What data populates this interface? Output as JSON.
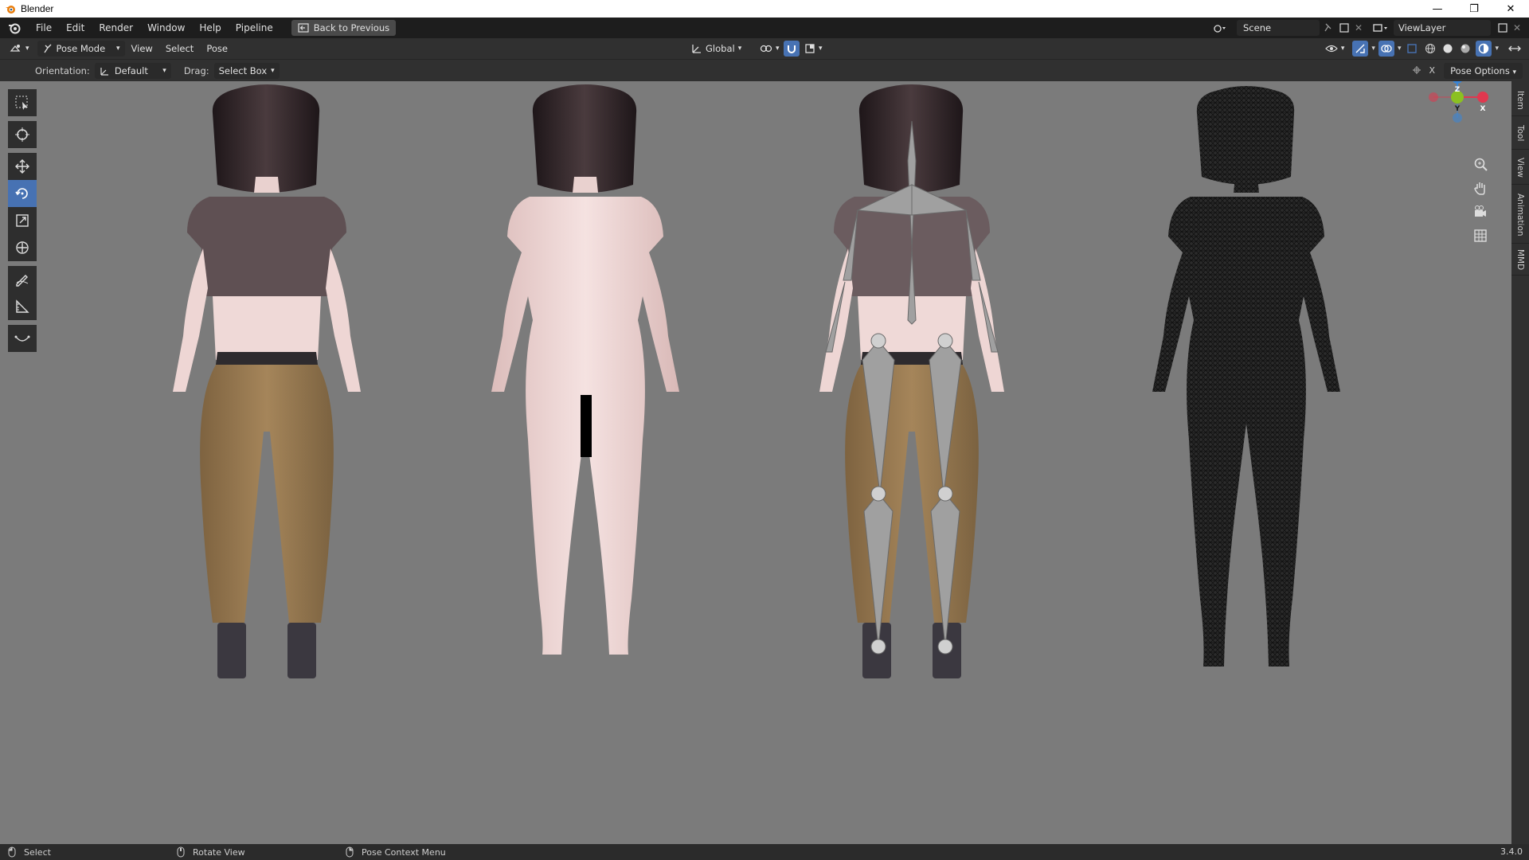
{
  "window": {
    "title": "Blender"
  },
  "menubar": {
    "items": [
      "File",
      "Edit",
      "Render",
      "Window",
      "Help",
      "Pipeline"
    ],
    "back_button": "Back to Previous",
    "scene": "Scene",
    "view_layer": "ViewLayer"
  },
  "header": {
    "mode": "Pose Mode",
    "menus": [
      "View",
      "Select",
      "Pose"
    ],
    "transform_orientation": "Global"
  },
  "tool_settings": {
    "orientation_label": "Orientation:",
    "orientation_value": "Default",
    "drag_label": "Drag:",
    "drag_value": "Select Box",
    "pose_options": "Pose Options"
  },
  "gizmo": {
    "axes": [
      "Z",
      "Y",
      "X"
    ],
    "colors": {
      "x": "#e0384f",
      "y": "#8bc121",
      "z": "#3a86d8"
    }
  },
  "sidebar_tabs": [
    "Item",
    "Tool",
    "View",
    "Animation",
    "MMD"
  ],
  "statusbar": {
    "left_action": "Select",
    "middle_action": "Rotate View",
    "right_action": "Pose Context Menu",
    "version": "3.4.0"
  },
  "colors": {
    "viewport_bg": "#7b7b7b",
    "active_tool": "#4772b3",
    "hair": "#2a2024",
    "skin": "#f0d8d6",
    "top": "#5e4f52",
    "pants": "#9c7d4e",
    "boots": "#3b3840",
    "wire": "#1e1e1e",
    "bone": "#a0a0a0"
  }
}
